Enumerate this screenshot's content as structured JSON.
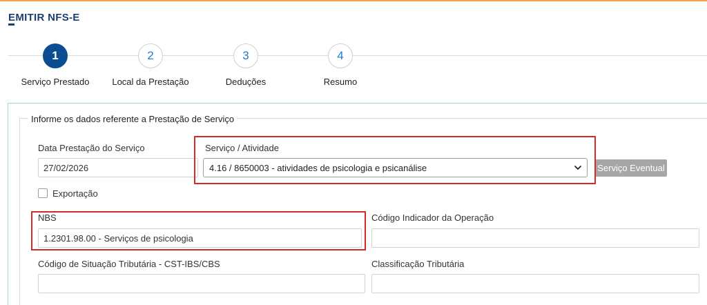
{
  "header": {
    "title_first_letter": "E",
    "title_rest": "MITIR NFS-E"
  },
  "steps": [
    {
      "number": "1",
      "label": "Serviço Prestado",
      "active": true
    },
    {
      "number": "2",
      "label": "Local da Prestação",
      "active": false
    },
    {
      "number": "3",
      "label": "Deduções",
      "active": false
    },
    {
      "number": "4",
      "label": "Resumo",
      "active": false
    }
  ],
  "form": {
    "legend": "Informe os dados referente a Prestação de Serviço",
    "data_prestacao": {
      "label": "Data Prestação do Serviço",
      "value": "27/02/2026"
    },
    "servico": {
      "label": "Serviço / Atividade",
      "selected": "4.16 / 8650003 - atividades de psicologia e psicanálise"
    },
    "servico_eventual_button": "Serviço Eventual",
    "exportacao_label": "Exportação",
    "nbs": {
      "label": "NBS",
      "value": "1.2301.98.00 - Serviços de psicologia"
    },
    "codigo_indicador": {
      "label": "Código Indicador da Operação",
      "value": ""
    },
    "cst": {
      "label": "Código de Situação Tributária - CST-IBS/CBS",
      "value": ""
    },
    "classificacao": {
      "label": "Classificação Tributária",
      "value": ""
    }
  },
  "colors": {
    "brand_blue": "#0b4d91",
    "step_number_blue": "#2678d2",
    "highlight_red": "#d62828",
    "top_accent": "#f6a04d"
  }
}
